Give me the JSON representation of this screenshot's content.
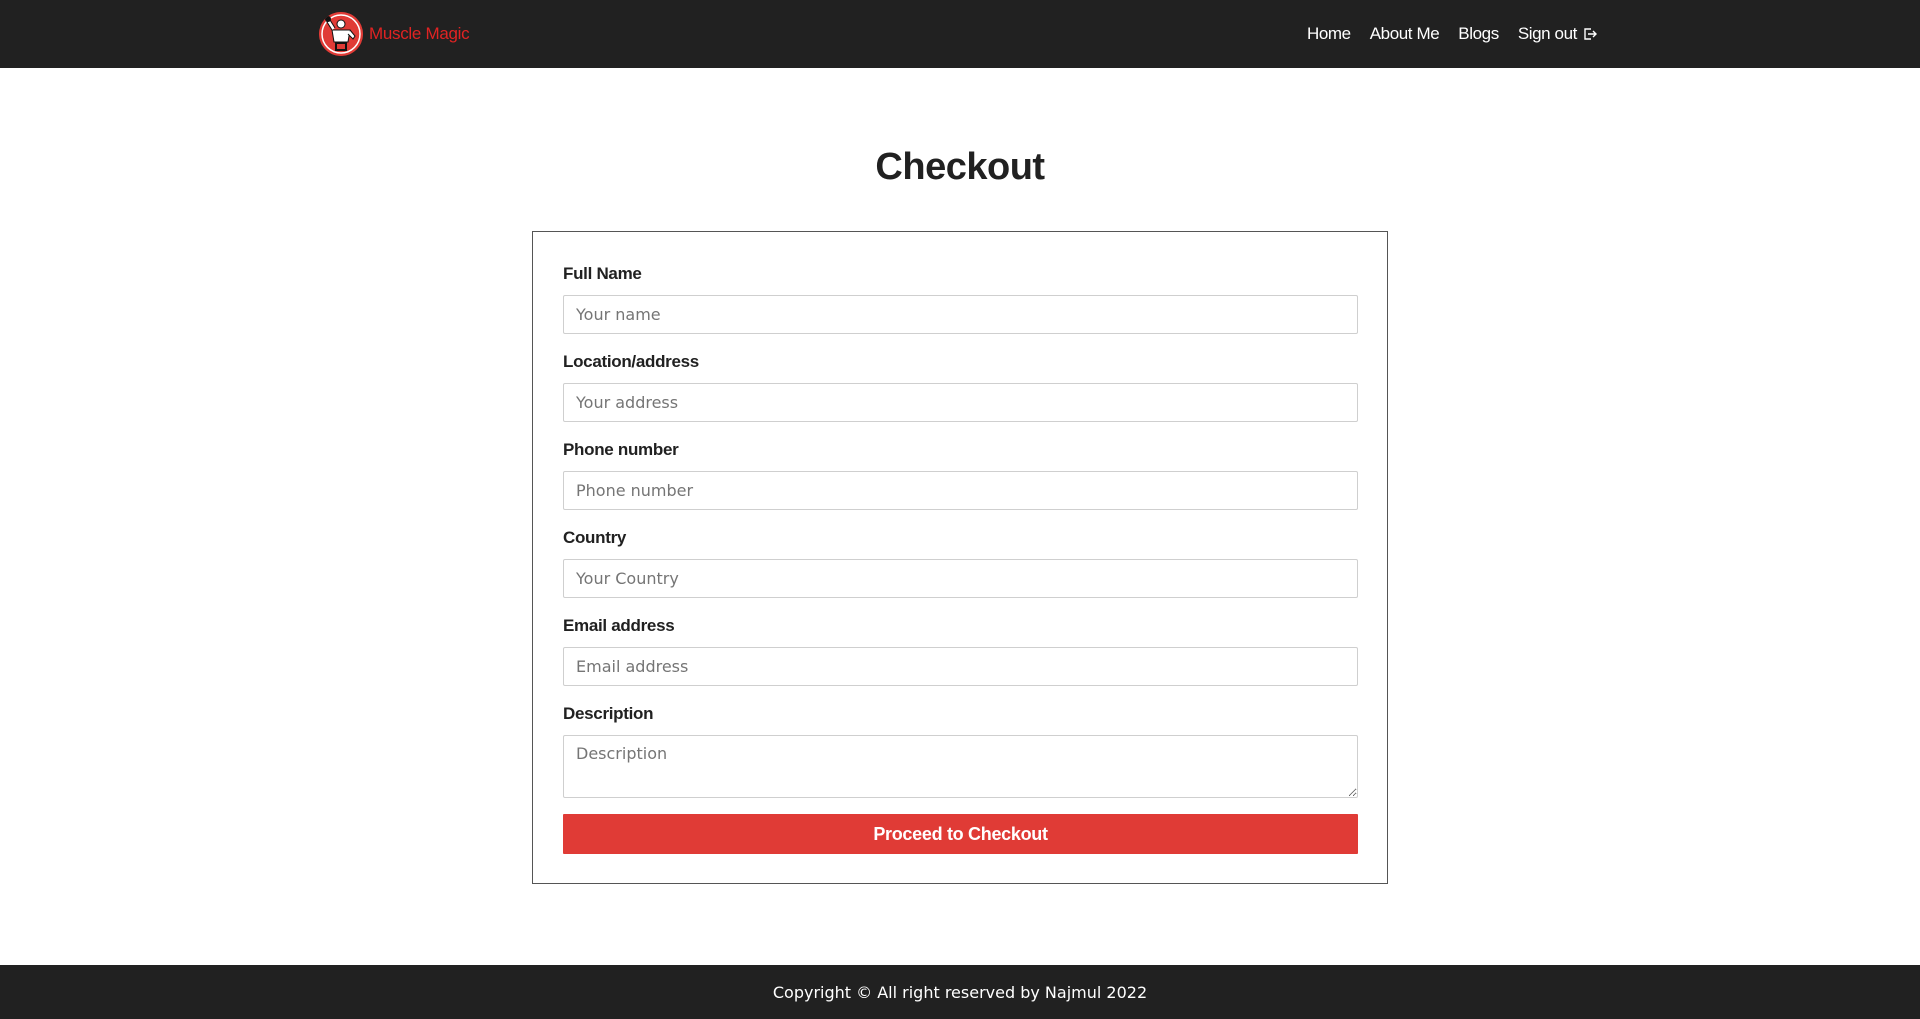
{
  "brand": {
    "name": "Muscle Magic",
    "logo_icon": "bodybuilder-logo-icon",
    "accent_color": "#e02323"
  },
  "nav": {
    "items": [
      {
        "label": "Home"
      },
      {
        "label": "About Me"
      },
      {
        "label": "Blogs"
      },
      {
        "label": "Sign out",
        "icon": "sign-out-icon"
      }
    ]
  },
  "main": {
    "title": "Checkout",
    "form": {
      "fields": [
        {
          "label": "Full Name",
          "placeholder": "Your name",
          "value": ""
        },
        {
          "label": "Location/address",
          "placeholder": "Your address",
          "value": ""
        },
        {
          "label": "Phone number",
          "placeholder": "Phone number",
          "value": ""
        },
        {
          "label": "Country",
          "placeholder": "Your Country",
          "value": ""
        },
        {
          "label": "Email address",
          "placeholder": "Email address",
          "value": ""
        },
        {
          "label": "Description",
          "placeholder": "Description",
          "value": ""
        }
      ],
      "submit_label": "Proceed to Checkout",
      "submit_color": "#e03b36"
    }
  },
  "footer": {
    "text": "Copyright © All right reserved by Najmul 2022"
  },
  "colors": {
    "navbar_bg": "#212121",
    "footer_bg": "#212121"
  }
}
